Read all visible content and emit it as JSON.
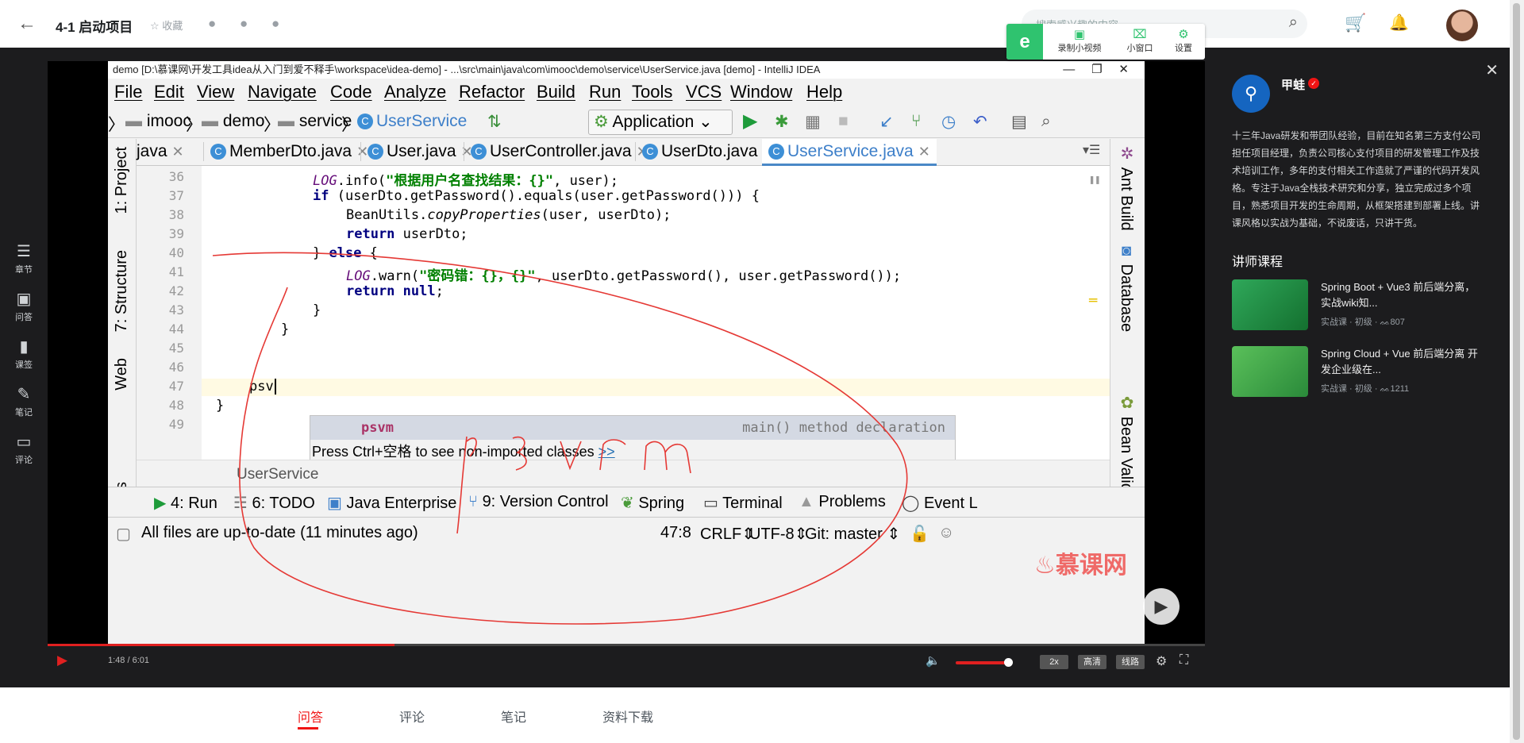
{
  "lesson_title": "4-1 启动项目",
  "favorite_label": "收藏",
  "search_placeholder": "搜索感兴趣的内容",
  "left_rail": [
    {
      "label": "章节"
    },
    {
      "label": "问答"
    },
    {
      "label": "课签"
    },
    {
      "label": "笔记"
    },
    {
      "label": "评论"
    }
  ],
  "recorder": {
    "badge": "e",
    "items": [
      {
        "label": "录制小视频"
      },
      {
        "label": "小窗口"
      },
      {
        "label": "设置"
      }
    ]
  },
  "ide": {
    "window_title": "demo [D:\\慕课网\\开发工具idea从入门到爱不释手\\workspace\\idea-demo] - ...\\src\\main\\java\\com\\imooc\\demo\\service\\UserService.java [demo] - IntelliJ IDEA",
    "menu": [
      "File",
      "Edit",
      "View",
      "Navigate",
      "Code",
      "Analyze",
      "Refactor",
      "Build",
      "Run",
      "Tools",
      "VCS",
      "Window",
      "Help"
    ],
    "nav": {
      "crumbs": [
        "imooc",
        "demo",
        "service",
        "UserService"
      ],
      "run_config": "Application"
    },
    "tabs": [
      {
        "label": "java"
      },
      {
        "label": "MemberDto.java"
      },
      {
        "label": "User.java"
      },
      {
        "label": "UserController.java"
      },
      {
        "label": "UserDto.java"
      },
      {
        "label": "UserService.java"
      }
    ],
    "left_tools": [
      "1: Project",
      "7: Structure",
      "Web",
      "orites"
    ],
    "right_tools": [
      "Ant Build",
      "Database",
      "Bean Validation"
    ],
    "line_numbers": [
      "36",
      "37",
      "38",
      "39",
      "40",
      "41",
      "42",
      "43",
      "44",
      "45",
      "46",
      "47",
      "48",
      "49"
    ],
    "code": {
      "l36a": "LOG",
      ".l36": "",
      "l36b": ".info(",
      "l36s": "\"根据用户名查找结果：{}\"",
      "l36c": ", user);",
      "l37a": "if",
      " l37": "",
      "l37b": " (userDto.getPassword().equals(user.getPassword())) {",
      "l38a": "BeanUtils.",
      "l38b": "copyProperties",
      "l38c": "(user, userDto);",
      "l39a": "return",
      "l39b": " userDto;",
      "l40a": "} ",
      "l40b": "else",
      " l40c": "",
      "l40d": " {",
      "l41a": "LOG",
      "l41b": ".warn(",
      "l41s": "\"密码错：{}，{}\"",
      "l41c": ", userDto.getPassword(), user.getPassword());",
      "l42a": "return",
      "l42b": " null",
      "l42c": ";",
      "l43": "}",
      "l44": "}",
      "l47": "psv",
      "l48": "}"
    },
    "completion": {
      "item": "psvm",
      "desc": "main() method declaration",
      "hint": "Press Ctrl+空格 to see non-imported classes",
      "hint_link": ">>"
    },
    "breadcrumb": "UserService",
    "tool_windows": [
      {
        "label": "4: Run"
      },
      {
        "label": "6: TODO"
      },
      {
        "label": "Java Enterprise"
      },
      {
        "label": "9: Version Control"
      },
      {
        "label": "Spring"
      },
      {
        "label": "Terminal"
      },
      {
        "label": "Problems"
      },
      {
        "label": "Event L"
      }
    ],
    "status": {
      "message": "All files are up-to-date (11 minutes ago)",
      "position": "47:8",
      "line_sep": "CRLF",
      "encoding": "UTF-8",
      "git": "Git: master"
    }
  },
  "watermark": "慕课网",
  "player": {
    "time": "1:48 / 6:01",
    "progress_fraction": 0.3,
    "volume_fraction": 0.78,
    "speed": "2x",
    "quality": "高清",
    "route": "线路"
  },
  "teacher": {
    "name": "甲蛙",
    "description": "十三年Java研发和带团队经验，目前在知名第三方支付公司担任项目经理，负责公司核心支付项目的研发管理工作及技术培训工作，多年的支付相关工作造就了严谨的代码开发风格。专注于Java全栈技术研究和分享，独立完成过多个项目，熟悉项目开发的生命周期，从框架搭建到部署上线。讲课风格以实战为基础，不说废话，只讲干货。",
    "courses_heading": "讲师课程",
    "courses": [
      {
        "title": "Spring Boot + Vue3 前后端分离，实战wiki知...",
        "meta": "实战课 · 初级 · ᨐ807"
      },
      {
        "title": "Spring Cloud + Vue 前后端分离 开发企业级在...",
        "meta": "实战课 · 初级 · ᨐ1211"
      }
    ]
  },
  "bottom_tabs": [
    "问答",
    "评论",
    "笔记",
    "资料下载"
  ],
  "colors": {
    "accent": "#f01414",
    "recorder_green": "#2fc36f",
    "annotation": "#e53935"
  }
}
